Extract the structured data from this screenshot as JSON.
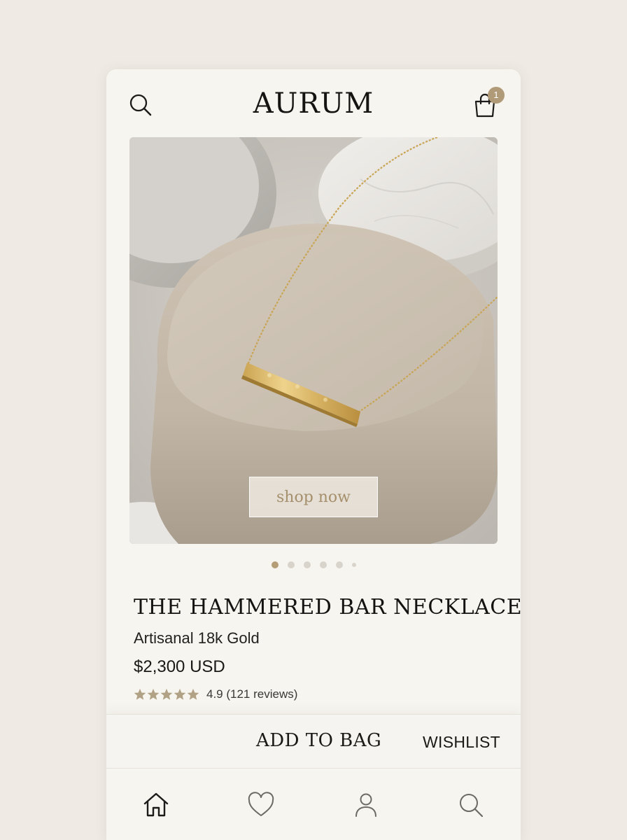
{
  "header": {
    "brand": "AURUM",
    "bag_count": "1",
    "icons": [
      "search-icon",
      "shopping-bag-icon"
    ]
  },
  "hero": {
    "image": "gold hammered bar necklace on beige suede display block",
    "cta_label": "shop now",
    "carousel": {
      "total": 6,
      "active_index": 0
    }
  },
  "product": {
    "title": "THE HAMMERED BAR NECKLACE",
    "subtitle": "Artisanal 18k Gold",
    "price": "$2,300 USD",
    "rating_stars": 5,
    "rating_text": "4.9 (121 reviews)"
  },
  "actions": {
    "add_to_bag": "ADD TO BAG",
    "wishlist": "WISHLIST"
  },
  "tabbar": {
    "items": [
      "home-icon",
      "heart-icon",
      "user-icon",
      "search-icon"
    ]
  },
  "colors": {
    "background": "#efebe4",
    "card": "#f7f5f0",
    "accent_gold": "#b09a78",
    "text": "#1e1c1a"
  }
}
